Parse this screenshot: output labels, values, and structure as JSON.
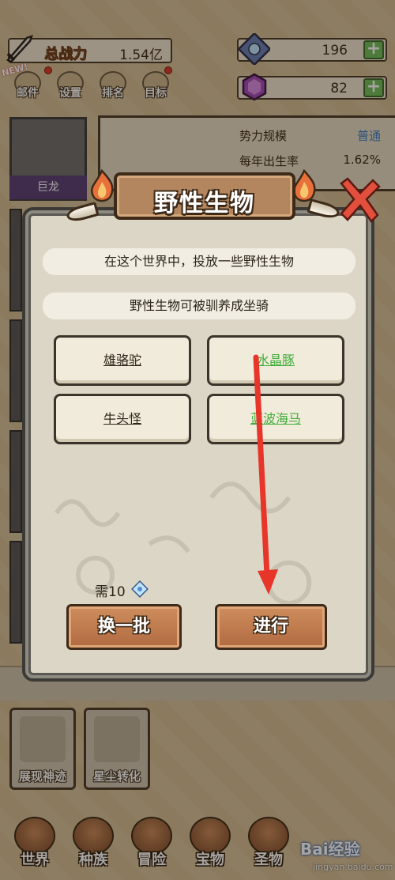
{
  "topbar": {
    "power_label": "总战力",
    "power_value": "1.54亿",
    "crystal_value": "196",
    "gem_value": "82",
    "new_badge": "NEW!"
  },
  "menu": [
    {
      "label": "邮件",
      "icon": "mail-icon"
    },
    {
      "label": "设置",
      "icon": "gear-icon"
    },
    {
      "label": "排名",
      "icon": "trophy-icon"
    },
    {
      "label": "目标",
      "icon": "scroll-icon"
    }
  ],
  "background": {
    "card_name": "巨龙",
    "stats": [
      {
        "label": "势力规模",
        "value": "普通"
      },
      {
        "label": "每年出生率",
        "value": "1.62%"
      }
    ]
  },
  "modal": {
    "title": "野性生物",
    "lines": [
      "在这个世界中，投放一些野性生物",
      "野性生物可被驯养成坐骑"
    ],
    "options": [
      {
        "label": "雄骆驼",
        "rarity": "normal"
      },
      {
        "label": "水晶豚",
        "rarity": "rare"
      },
      {
        "label": "牛头怪",
        "rarity": "normal"
      },
      {
        "label": "蓝波海马",
        "rarity": "rare"
      }
    ],
    "cost_label": "需10",
    "refresh_label": "换一批",
    "proceed_label": "进行",
    "colors": {
      "rare": "#3fae3a",
      "normal": "#2b2418",
      "arrow": "#e8352a"
    }
  },
  "abilities": [
    {
      "label": "展现神迹"
    },
    {
      "label": "星尘转化"
    }
  ],
  "nav": [
    {
      "label": "世界"
    },
    {
      "label": "种族"
    },
    {
      "label": "冒险"
    },
    {
      "label": "宝物"
    },
    {
      "label": "圣物"
    }
  ],
  "watermark": {
    "main": "Bai经验",
    "sub": "jingyan.baidu.com"
  }
}
